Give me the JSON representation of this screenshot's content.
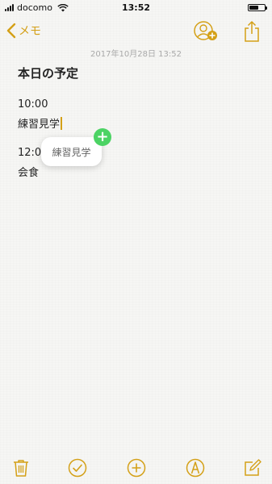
{
  "status": {
    "carrier": "docomo",
    "time": "13:52",
    "battery_level": 0.6
  },
  "nav": {
    "back_label": "メモ",
    "collab_icon": "add-person-icon",
    "share_icon": "share-icon"
  },
  "note": {
    "date": "2017年10月28日 13:52",
    "title": "本日の予定",
    "lines": [
      "10:00",
      "練習見学",
      "12:00",
      "会食"
    ]
  },
  "popup": {
    "label": "練習見学",
    "badge": "+"
  },
  "toolbar": {
    "icons": [
      "trash-icon",
      "checklist-icon",
      "add-icon",
      "markup-icon",
      "compose-icon"
    ]
  },
  "colors": {
    "accent": "#d4a017",
    "badge": "#4cd364",
    "paper": "#f6f6f4"
  }
}
